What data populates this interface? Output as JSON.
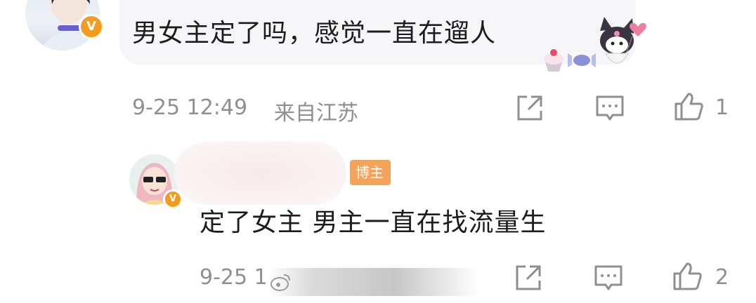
{
  "comments": [
    {
      "text": "男女主定了吗，感觉一直在遛人",
      "verified_badge": "V",
      "date": "9-25 12:49",
      "location": "来自江苏",
      "like_count": "1",
      "icons": [
        "share-icon",
        "comment-icon",
        "like-icon"
      ]
    },
    {
      "text": "定了女主 男主一直在找流量生",
      "verified_badge": "V",
      "role_badge": "博主",
      "date": "9-25 1",
      "like_count": "2",
      "icons": [
        "share-icon",
        "comment-icon",
        "like-icon"
      ]
    }
  ],
  "colors": {
    "text": "#1c1c1c",
    "meta": "#8f8f8f",
    "verified_orange": "#f59a1b",
    "host_badge": "#f4a35a",
    "bubble_bg": "#f6f6f8"
  }
}
